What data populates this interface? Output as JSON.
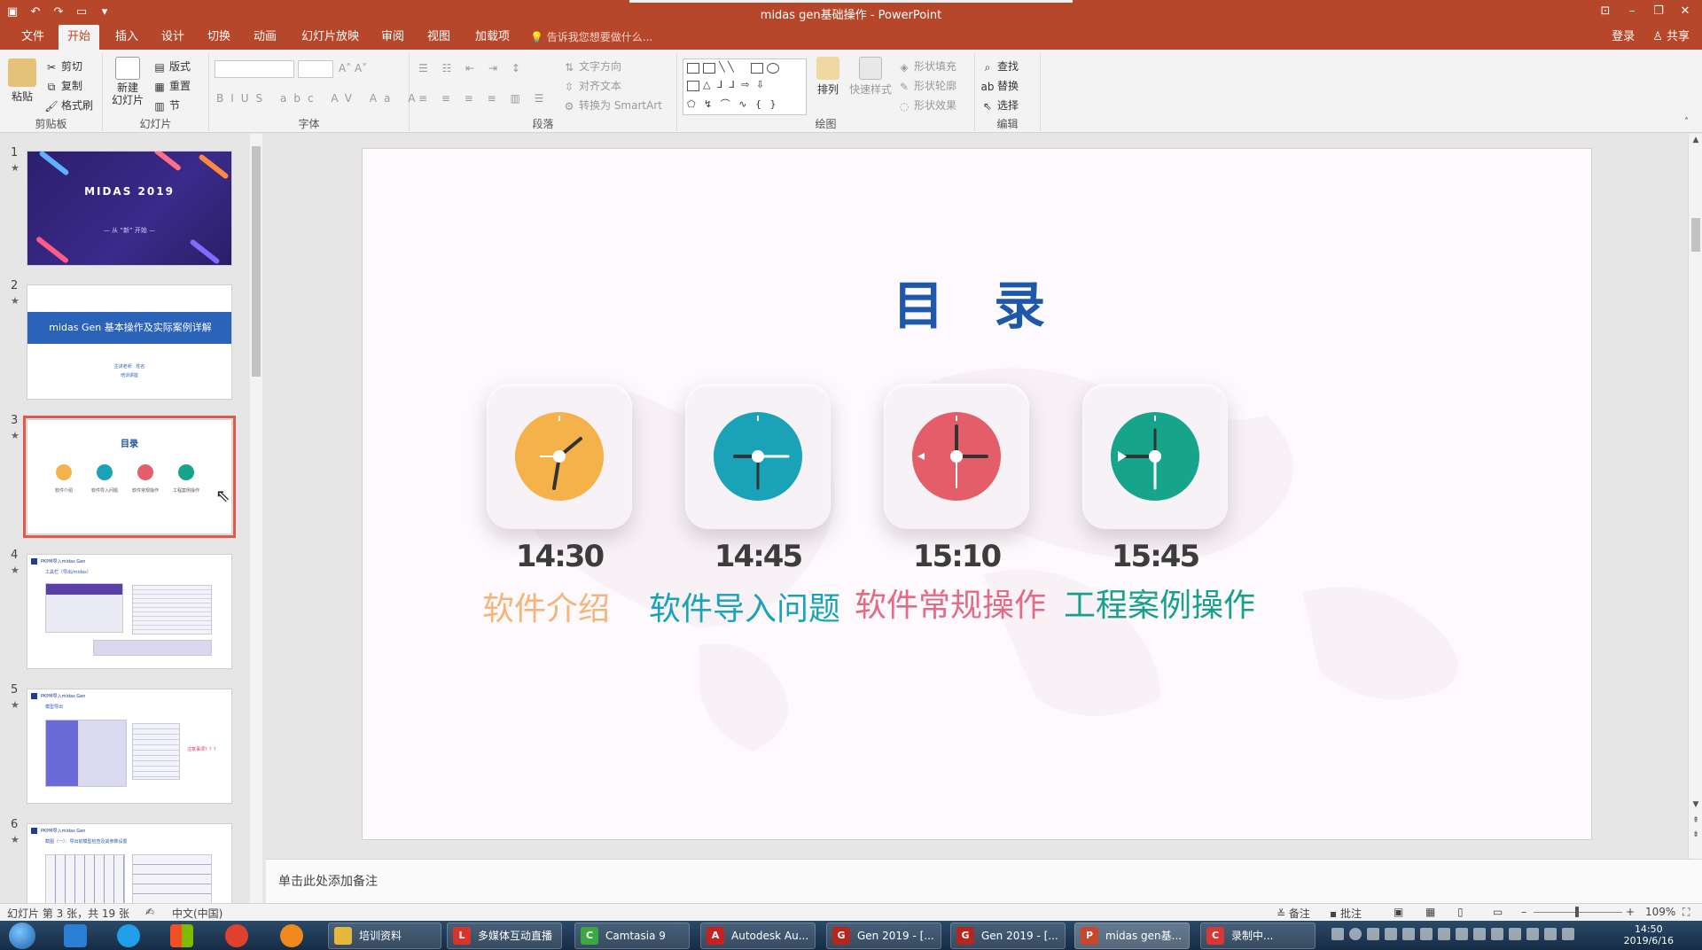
{
  "window": {
    "title": "midas gen基础操作 - PowerPoint",
    "qat": [
      "save-icon",
      "undo-icon",
      "redo-icon",
      "slideshow-icon",
      "customize-icon"
    ]
  },
  "tabs": [
    "文件",
    "开始",
    "插入",
    "设计",
    "切换",
    "动画",
    "幻灯片放映",
    "审阅",
    "视图",
    "加载项"
  ],
  "active_tab": "开始",
  "tellme": "告诉我您想要做什么...",
  "account": {
    "login": "登录",
    "share": "共享"
  },
  "ribbon": {
    "clipboard": {
      "label": "剪贴板",
      "paste": "粘贴",
      "cut": "剪切",
      "copy": "复制",
      "format_painter": "格式刷"
    },
    "slides": {
      "label": "幻灯片",
      "new_slide": "新建",
      "new_slide2": "幻灯片",
      "layout": "版式",
      "reset": "重置",
      "section": "节"
    },
    "font": {
      "label": "字体"
    },
    "paragraph": {
      "label": "段落",
      "text_direction": "文字方向",
      "align_text": "对齐文本",
      "smartart": "转换为 SmartArt"
    },
    "drawing": {
      "label": "绘图",
      "arrange": "排列",
      "quick_styles": "快速样式",
      "shape_fill": "形状填充",
      "shape_outline": "形状轮廓",
      "shape_effects": "形状效果"
    },
    "editing": {
      "label": "编辑",
      "find": "查找",
      "replace": "替换",
      "select": "选择"
    }
  },
  "thumbnails": [
    {
      "num": "1",
      "title": "MIDAS 2019",
      "subtitle": "— 从 “新” 开始 —"
    },
    {
      "num": "2",
      "title": "midas Gen 基本操作及实际案例详解",
      "line1": "主讲老师 · 姓名",
      "line2": "培训讲座"
    },
    {
      "num": "3",
      "title": "目录",
      "labels": [
        "软件介绍",
        "软件导入问题",
        "软件常规操作",
        "工程案例操作"
      ]
    },
    {
      "num": "4",
      "title": "PKPM导入midas Gen",
      "sub": "工具栏（导出/midas）"
    },
    {
      "num": "5",
      "title": "PKPM导入midas Gen",
      "sub": "模型导出",
      "note": "注意事项？？？"
    },
    {
      "num": "6",
      "title": "PKPM导入midas Gen",
      "sub": "截图（一）：导出前模型检查及其参数设置"
    }
  ],
  "slide": {
    "title": "目 录",
    "items": [
      {
        "time": "14:30",
        "label": "软件介绍",
        "color": "#f5b24a",
        "label_color": "#f3b57a"
      },
      {
        "time": "14:45",
        "label": "软件导入问题",
        "color": "#1aa3b8",
        "label_color": "#1aa3b8"
      },
      {
        "time": "15:10",
        "label": "软件常规操作",
        "color": "#e45e6a",
        "label_color": "#e26b86"
      },
      {
        "time": "15:45",
        "label": "工程案例操作",
        "color": "#16a58a",
        "label_color": "#17a08a"
      }
    ]
  },
  "notes_placeholder": "单击此处添加备注",
  "status": {
    "slide_info": "幻灯片 第 3 张，共 19 张",
    "language": "中文(中国)",
    "notes": "备注",
    "comments": "批注",
    "zoom": "109%"
  },
  "taskbar": {
    "windows": [
      {
        "label": "培训资料",
        "icon": "folder-icon",
        "color": "#e8b83c"
      },
      {
        "label": "多媒体互动直播",
        "icon": "live-icon",
        "color": "#d9342b"
      },
      {
        "label": "Camtasia 9",
        "icon": "camtasia-icon",
        "color": "#3aa843"
      },
      {
        "label": "Autodesk Au...",
        "icon": "autocad-icon",
        "color": "#c81f1f"
      },
      {
        "label": "Gen 2019 - [...",
        "icon": "gen-icon",
        "color": "#b5261e"
      },
      {
        "label": "Gen 2019 - [...",
        "icon": "gen-icon",
        "color": "#b5261e"
      },
      {
        "label": "midas gen基...",
        "icon": "powerpoint-icon",
        "color": "#c8462a"
      },
      {
        "label": "录制中...",
        "icon": "recording-icon",
        "color": "#d93636"
      }
    ],
    "time": "14:50",
    "date": "2019/6/16"
  }
}
